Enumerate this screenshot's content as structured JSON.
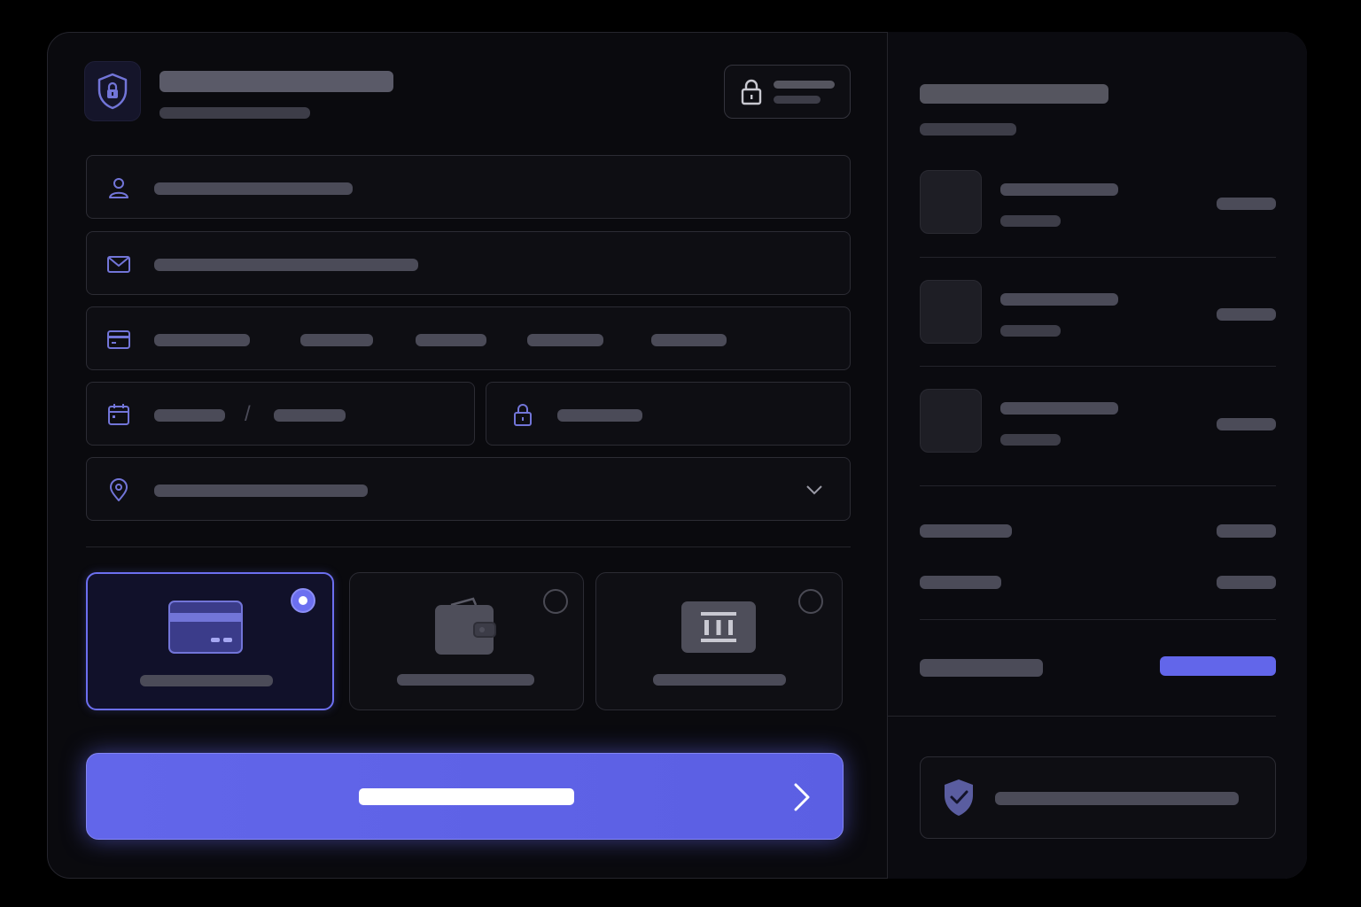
{
  "window": {
    "title": "",
    "subtitle": ""
  },
  "header": {
    "secure_badge_label": "",
    "secure_badge_sublabel": "",
    "icon": "shield-lock-icon"
  },
  "form": {
    "name_field": {
      "icon": "user-icon",
      "value": ""
    },
    "email_field": {
      "icon": "mail-icon",
      "value": ""
    },
    "card_number_field": {
      "icon": "credit-card-icon",
      "groups": [
        "",
        "",
        "",
        "",
        ""
      ]
    },
    "expiry_field": {
      "icon": "calendar-icon",
      "month": "",
      "separator": "/",
      "year": ""
    },
    "cvc_field": {
      "icon": "lock-icon",
      "value": ""
    },
    "address_field": {
      "icon": "map-pin-icon",
      "value": "",
      "dropdown_icon": "chevron-down-icon"
    }
  },
  "payment_methods": [
    {
      "icon": "credit-card-icon",
      "label": "",
      "selected": true
    },
    {
      "icon": "wallet-icon",
      "label": "",
      "selected": false
    },
    {
      "icon": "bank-icon",
      "label": "",
      "selected": false
    }
  ],
  "cta": {
    "label": "",
    "icon": "chevron-right-icon"
  },
  "summary": {
    "title": "",
    "subtitle": "",
    "items": [
      {
        "name": "",
        "meta": "",
        "price": ""
      },
      {
        "name": "",
        "meta": "",
        "price": ""
      },
      {
        "name": "",
        "meta": "",
        "price": ""
      }
    ],
    "subtotal_label": "",
    "subtotal_value": "",
    "tax_label": "",
    "tax_value": "",
    "total_label": "",
    "total_value": "",
    "trust_text": "",
    "trust_icon": "shield-check-icon"
  },
  "colors": {
    "background": "#000000",
    "card": "#0a0a0e",
    "accent": "#6266ea",
    "icon": "#7275d8",
    "placeholder": "#4b4b58"
  }
}
